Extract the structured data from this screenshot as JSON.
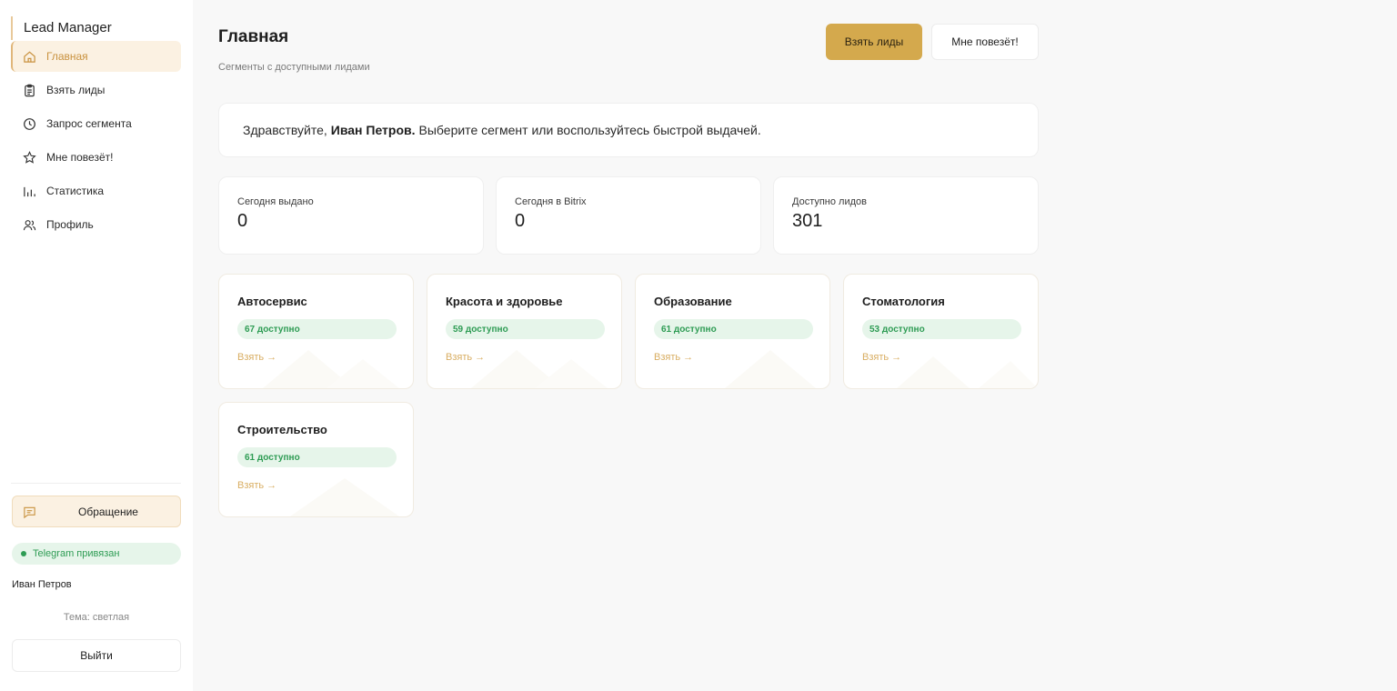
{
  "sidebar": {
    "brand": "Lead Manager",
    "items": [
      {
        "label": "Главная",
        "icon": "home-icon"
      },
      {
        "label": "Взять лиды",
        "icon": "clipboard-icon"
      },
      {
        "label": "Запрос сегмента",
        "icon": "clock-icon"
      },
      {
        "label": "Мне повезёт!",
        "icon": "star-icon"
      },
      {
        "label": "Статистика",
        "icon": "bar-chart-icon"
      },
      {
        "label": "Профиль",
        "icon": "users-icon"
      }
    ],
    "appeal_label": "Обращение",
    "telegram_status": "Telegram привязан",
    "user_name": "Иван Петров",
    "theme_label": "Тема: светлая",
    "logout_label": "Выйти"
  },
  "header": {
    "title": "Главная",
    "subtitle": "Сегменты с доступными лидами",
    "primary_button": "Взять лиды",
    "secondary_button": "Мне повезёт!"
  },
  "greeting": {
    "prefix": "Здравствуйте,",
    "name": "Иван Петров.",
    "suffix": "Выберите сегмент или воспользуйтесь быстрой выдачей."
  },
  "stats": [
    {
      "label": "Сегодня выдано",
      "value": "0"
    },
    {
      "label": "Сегодня в Bitrix",
      "value": "0"
    },
    {
      "label": "Доступно лидов",
      "value": "301"
    }
  ],
  "segments": [
    {
      "title": "Автосервис",
      "badge": "67 доступно",
      "action": "Взять →"
    },
    {
      "title": "Красота и здоровье",
      "badge": "59 доступно",
      "action": "Взять →"
    },
    {
      "title": "Образование",
      "badge": "61 доступно",
      "action": "Взять →"
    },
    {
      "title": "Стоматология",
      "badge": "53 доступно",
      "action": "Взять →"
    },
    {
      "title": "Строительство",
      "badge": "61 доступно",
      "action": "Взять →"
    }
  ],
  "colors": {
    "accent": "#d4a94d",
    "accent_light": "#fbf1e2",
    "success": "#2e9c54",
    "success_bg": "#e6f5ea"
  }
}
